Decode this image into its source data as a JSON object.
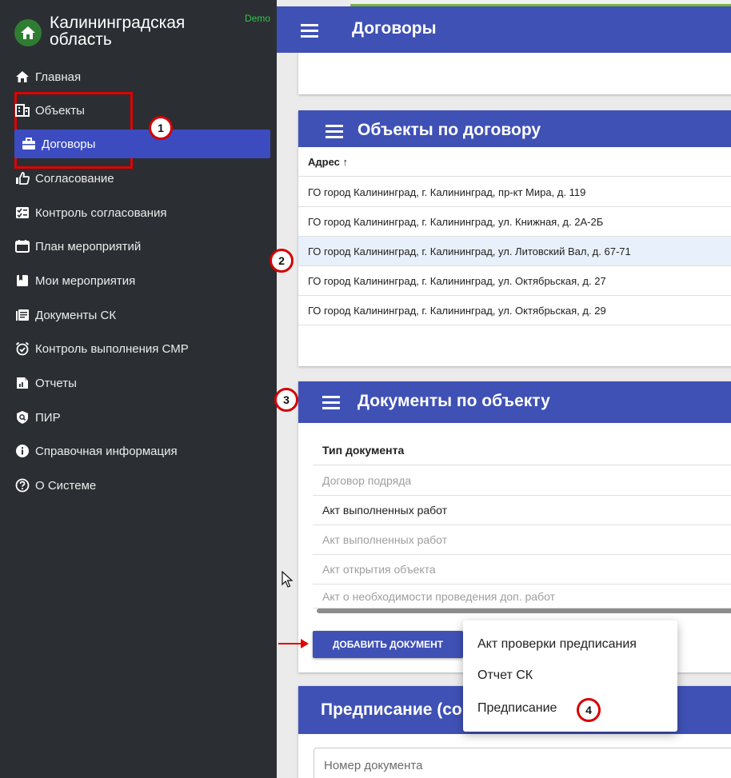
{
  "brand": {
    "title": "Калининградская область",
    "demo": "Demo"
  },
  "nav": [
    {
      "label": "Главная",
      "icon": "home-icon"
    },
    {
      "label": "Объекты",
      "icon": "building-icon"
    },
    {
      "label": "Договоры",
      "icon": "briefcase-icon",
      "active": true
    },
    {
      "label": "Согласование",
      "icon": "thumbs-up-icon"
    },
    {
      "label": "Контроль согласования",
      "icon": "checklist-icon"
    },
    {
      "label": "План мероприятий",
      "icon": "calendar-icon"
    },
    {
      "label": "Мои мероприятия",
      "icon": "bookmark-icon"
    },
    {
      "label": "Документы СК",
      "icon": "documents-icon"
    },
    {
      "label": "Контроль выполнения СМР",
      "icon": "alarm-check-icon"
    },
    {
      "label": "Отчеты",
      "icon": "report-icon"
    },
    {
      "label": "ПИР",
      "icon": "shield-search-icon"
    },
    {
      "label": "Справочная информация",
      "icon": "info-icon"
    },
    {
      "label": "О Системе",
      "icon": "help-icon"
    }
  ],
  "topbar": {
    "title": "Договоры"
  },
  "objects": {
    "title": "Объекты по договору",
    "column": "Адрес ↑",
    "rows": [
      "ГО город Калининград, г. Калининград, пр-кт Мира, д. 119",
      "ГО город Калининград, г. Калининград, ул. Книжная, д. 2А-2Б",
      "ГО город Калининград, г. Калининград, ул. Литовский Вал, д. 67-71",
      "ГО город Калининград, г. Калининград, ул. Октябрьская, д. 27",
      "ГО город Калининград, г. Калининград, ул. Октябрьская, д. 29"
    ]
  },
  "documents": {
    "title": "Документы по объекту",
    "column": "Тип документа",
    "rows": [
      "Договор подряда",
      "Акт выполненных работ",
      "Акт выполненных работ",
      "Акт открытия объекта",
      "Акт о необходимости проведения доп. работ"
    ],
    "add_button": "ДОБАВИТЬ ДОКУМЕНТ"
  },
  "menu": {
    "items": [
      "Акт проверки предписания",
      "Отчет СК",
      "Предписание"
    ]
  },
  "prescription": {
    "title": "Предписание (со",
    "field_placeholder": "Номер документа"
  },
  "callouts": [
    "1",
    "2",
    "3",
    "4"
  ],
  "colors": {
    "primary": "#3f51b5",
    "sidebar": "#2b2f33",
    "accent_red": "#e00000",
    "demo_green": "#37c34a"
  }
}
